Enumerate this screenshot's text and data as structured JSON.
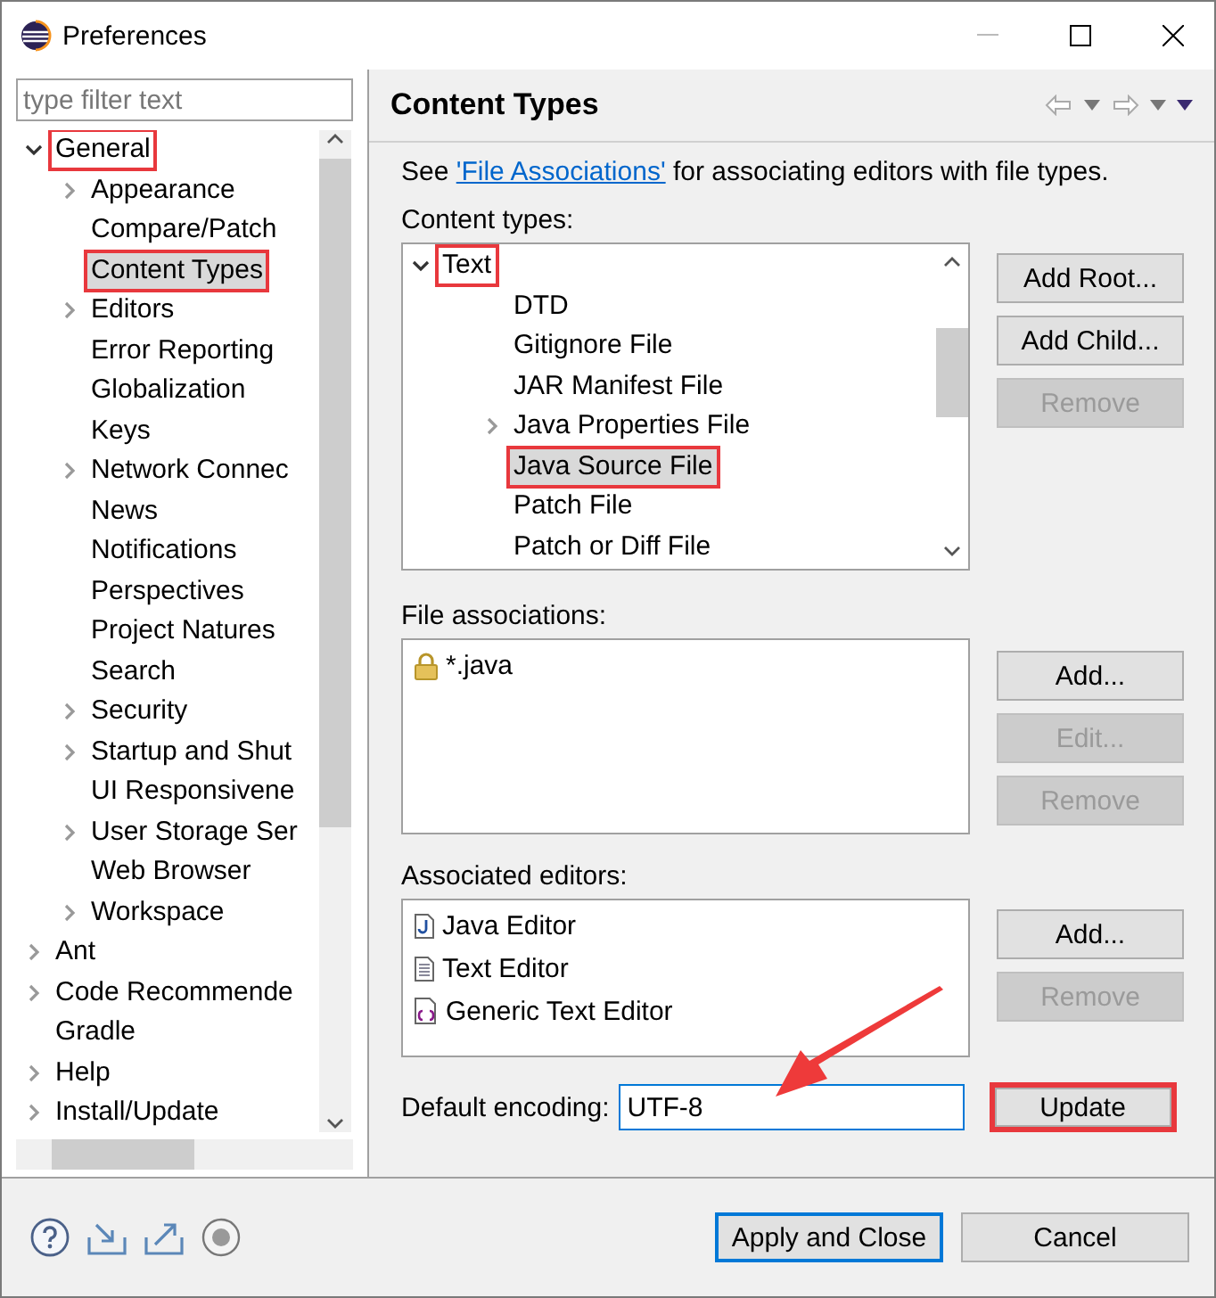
{
  "window": {
    "title": "Preferences"
  },
  "filter": {
    "placeholder": "type filter text"
  },
  "tree": [
    {
      "label": "General",
      "expanded": true,
      "selected": false,
      "highlighted": true,
      "children": [
        {
          "label": "Appearance",
          "expanded": false,
          "selected": false,
          "highlighted": false
        },
        {
          "label": "Compare/Patch",
          "selected": false,
          "highlighted": false
        },
        {
          "label": "Content Types",
          "selected": true,
          "highlighted": true
        },
        {
          "label": "Editors",
          "expanded": false,
          "selected": false,
          "highlighted": false
        },
        {
          "label": "Error Reporting",
          "selected": false,
          "highlighted": false
        },
        {
          "label": "Globalization",
          "selected": false,
          "highlighted": false
        },
        {
          "label": "Keys",
          "selected": false,
          "highlighted": false
        },
        {
          "label": "Network Connec",
          "expanded": false,
          "selected": false,
          "highlighted": false
        },
        {
          "label": "News",
          "selected": false,
          "highlighted": false
        },
        {
          "label": "Notifications",
          "selected": false,
          "highlighted": false
        },
        {
          "label": "Perspectives",
          "selected": false,
          "highlighted": false
        },
        {
          "label": "Project Natures",
          "selected": false,
          "highlighted": false
        },
        {
          "label": "Search",
          "selected": false,
          "highlighted": false
        },
        {
          "label": "Security",
          "expanded": false,
          "selected": false,
          "highlighted": false
        },
        {
          "label": "Startup and Shut",
          "expanded": false,
          "selected": false,
          "highlighted": false
        },
        {
          "label": "UI Responsivene",
          "selected": false,
          "highlighted": false
        },
        {
          "label": "User Storage Ser",
          "expanded": false,
          "selected": false,
          "highlighted": false
        },
        {
          "label": "Web Browser",
          "selected": false,
          "highlighted": false
        },
        {
          "label": "Workspace",
          "expanded": false,
          "selected": false,
          "highlighted": false
        }
      ]
    },
    {
      "label": "Ant",
      "expanded": false,
      "selected": false,
      "highlighted": false
    },
    {
      "label": "Code Recommende",
      "expanded": false,
      "selected": false,
      "highlighted": false
    },
    {
      "label": "Gradle",
      "selected": false,
      "highlighted": false
    },
    {
      "label": "Help",
      "expanded": false,
      "selected": false,
      "highlighted": false
    },
    {
      "label": "Install/Update",
      "expanded": false,
      "selected": false,
      "highlighted": false
    }
  ],
  "page": {
    "title": "Content Types",
    "intro_before": "See ",
    "intro_link": "'File Associations'",
    "intro_after": " for associating editors with file types.",
    "content_types_label": "Content types:",
    "content_types": [
      {
        "label": "Text",
        "expanded": true,
        "selected": false,
        "highlighted": true,
        "children": [
          {
            "label": "DTD",
            "selected": false,
            "highlighted": false
          },
          {
            "label": "Gitignore File",
            "selected": false,
            "highlighted": false
          },
          {
            "label": "JAR Manifest File",
            "selected": false,
            "highlighted": false
          },
          {
            "label": "Java Properties File",
            "expanded": false,
            "selected": false,
            "highlighted": false
          },
          {
            "label": "Java Source File",
            "selected": true,
            "highlighted": true
          },
          {
            "label": "Patch File",
            "selected": false,
            "highlighted": false
          },
          {
            "label": "Patch or Diff File",
            "selected": false,
            "highlighted": false
          }
        ]
      }
    ],
    "content_type_buttons": [
      {
        "label": "Add Root...",
        "disabled": false
      },
      {
        "label": "Add Child...",
        "disabled": false
      },
      {
        "label": "Remove",
        "disabled": true
      }
    ],
    "file_associations_label": "File associations:",
    "file_associations": [
      {
        "label": "*.java",
        "kind": "locked"
      }
    ],
    "file_association_buttons": [
      {
        "label": "Add...",
        "disabled": false
      },
      {
        "label": "Edit...",
        "disabled": true
      },
      {
        "label": "Remove",
        "disabled": true
      }
    ],
    "associated_editors_label": "Associated editors:",
    "associated_editors": [
      {
        "label": "Java Editor",
        "kind": "java"
      },
      {
        "label": "Text Editor",
        "kind": "text"
      },
      {
        "label": "Generic Text Editor",
        "kind": "generic"
      }
    ],
    "associated_editor_buttons": [
      {
        "label": "Add...",
        "disabled": false
      },
      {
        "label": "Remove",
        "disabled": true
      }
    ],
    "encoding_label": "Default encoding:",
    "encoding_value": "UTF-8",
    "update_button": {
      "label": "Update",
      "highlighted": true
    }
  },
  "footer_buttons": [
    {
      "label": "Apply and Close",
      "default": true
    },
    {
      "label": "Cancel",
      "default": false
    }
  ]
}
